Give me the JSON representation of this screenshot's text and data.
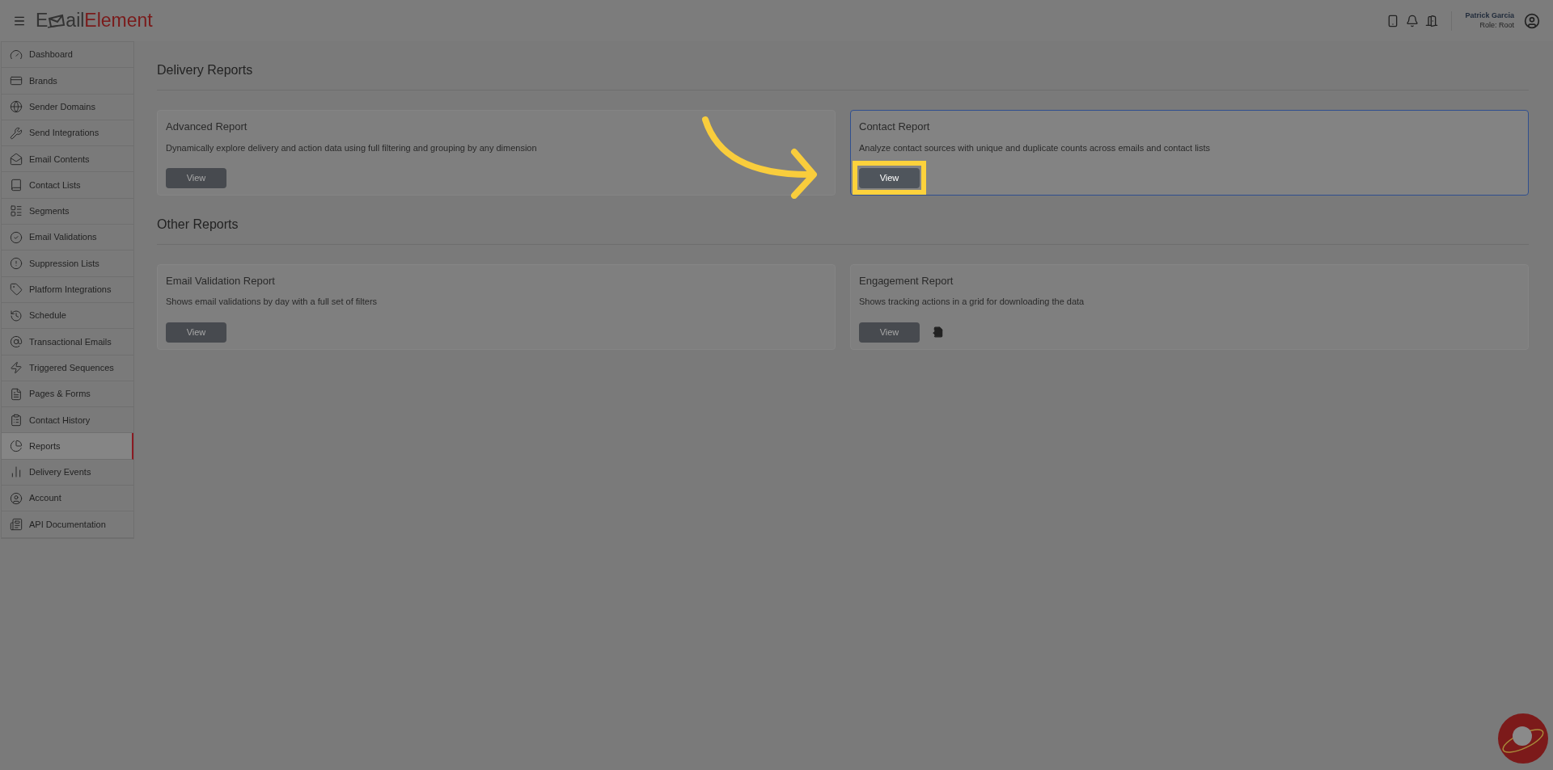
{
  "header": {
    "logo": {
      "lead": "E",
      "mid": "ail",
      "brand": "Element"
    },
    "user": {
      "name": "Patrick Garcia",
      "role": "Role: Root"
    }
  },
  "sidebar": {
    "items": [
      {
        "label": "Dashboard",
        "selected": false
      },
      {
        "label": "Brands",
        "selected": false
      },
      {
        "label": "Sender Domains",
        "selected": false
      },
      {
        "label": "Send Integrations",
        "selected": false
      },
      {
        "label": "Email Contents",
        "selected": false
      },
      {
        "label": "Contact Lists",
        "selected": false
      },
      {
        "label": "Segments",
        "selected": false
      },
      {
        "label": "Email Validations",
        "selected": false
      },
      {
        "label": "Suppression Lists",
        "selected": false
      },
      {
        "label": "Platform Integrations",
        "selected": false
      },
      {
        "label": "Schedule",
        "selected": false
      },
      {
        "label": "Transactional Emails",
        "selected": false
      },
      {
        "label": "Triggered Sequences",
        "selected": false
      },
      {
        "label": "Pages & Forms",
        "selected": false
      },
      {
        "label": "Contact History",
        "selected": false
      },
      {
        "label": "Reports",
        "selected": true
      },
      {
        "label": "Delivery Events",
        "selected": false
      },
      {
        "label": "Account",
        "selected": false
      },
      {
        "label": "API Documentation",
        "selected": false
      }
    ]
  },
  "sections": [
    {
      "title": "Delivery Reports",
      "cards": [
        {
          "title": "Advanced Report",
          "description": "Dynamically explore delivery and action data using full filtering and grouping by any dimension",
          "button": "View",
          "highlighted": false,
          "export": false
        },
        {
          "title": "Contact Report",
          "description": "Analyze contact sources with unique and duplicate counts across emails and contact lists",
          "button": "View",
          "highlighted": true,
          "export": false
        }
      ]
    },
    {
      "title": "Other Reports",
      "cards": [
        {
          "title": "Email Validation Report",
          "description": "Shows email validations by day with a full set of filters",
          "button": "View",
          "highlighted": false,
          "export": false
        },
        {
          "title": "Engagement Report",
          "description": "Shows tracking actions in a grid for downloading the data",
          "button": "View",
          "highlighted": false,
          "export": true
        }
      ]
    }
  ]
}
